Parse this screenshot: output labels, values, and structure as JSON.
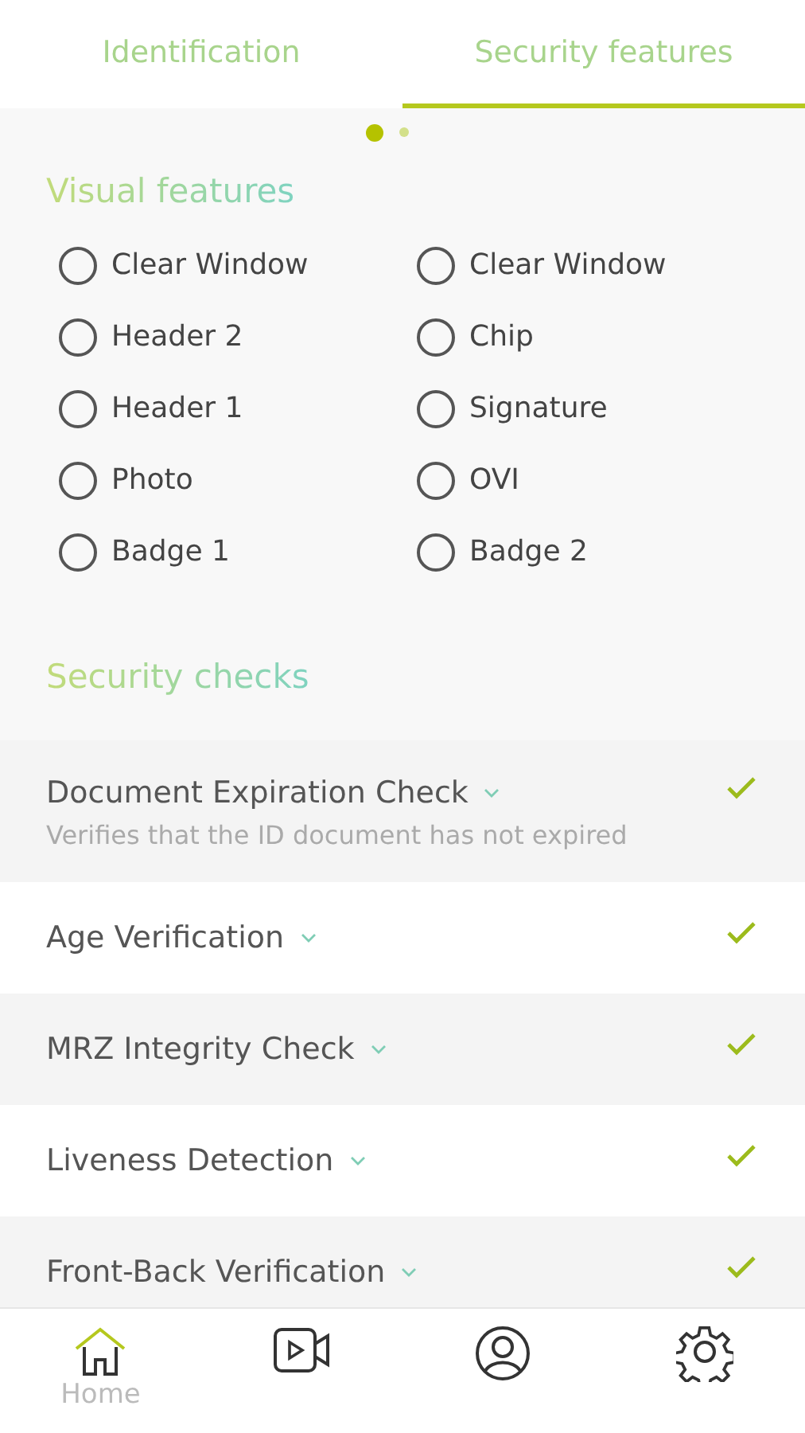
{
  "tabs": [
    {
      "label": "Identification",
      "selected": false
    },
    {
      "label": "Security features",
      "selected": true
    }
  ],
  "pager": [
    {
      "selected": true
    },
    {
      "selected": false
    }
  ],
  "visual_features": {
    "title": "Visual features",
    "options": [
      {
        "label": "Clear Window",
        "selected": false
      },
      {
        "label": "Clear Window",
        "selected": false
      },
      {
        "label": "Header 2",
        "selected": false
      },
      {
        "label": "Chip",
        "selected": false
      },
      {
        "label": "Header 1",
        "selected": false
      },
      {
        "label": "Signature",
        "selected": false
      },
      {
        "label": "Photo",
        "selected": false
      },
      {
        "label": "OVI",
        "selected": false
      },
      {
        "label": "Badge 1",
        "selected": false
      },
      {
        "label": "Badge 2",
        "selected": false
      }
    ]
  },
  "security_checks": {
    "title": "Security checks",
    "items": [
      {
        "name": "Document Expiration Check",
        "description": "Verifies that the ID document has not expired",
        "passed": true
      },
      {
        "name": "Age Verification",
        "passed": true
      },
      {
        "name": "MRZ Integrity Check",
        "passed": true
      },
      {
        "name": "Liveness Detection",
        "passed": true
      },
      {
        "name": "Front-Back Verification",
        "passed": true
      }
    ]
  },
  "bottom_nav": [
    {
      "kind": "home",
      "label": "Home",
      "selected": true
    },
    {
      "kind": "video",
      "selected": false
    },
    {
      "kind": "profile",
      "selected": false
    },
    {
      "kind": "settings",
      "selected": false
    }
  ]
}
